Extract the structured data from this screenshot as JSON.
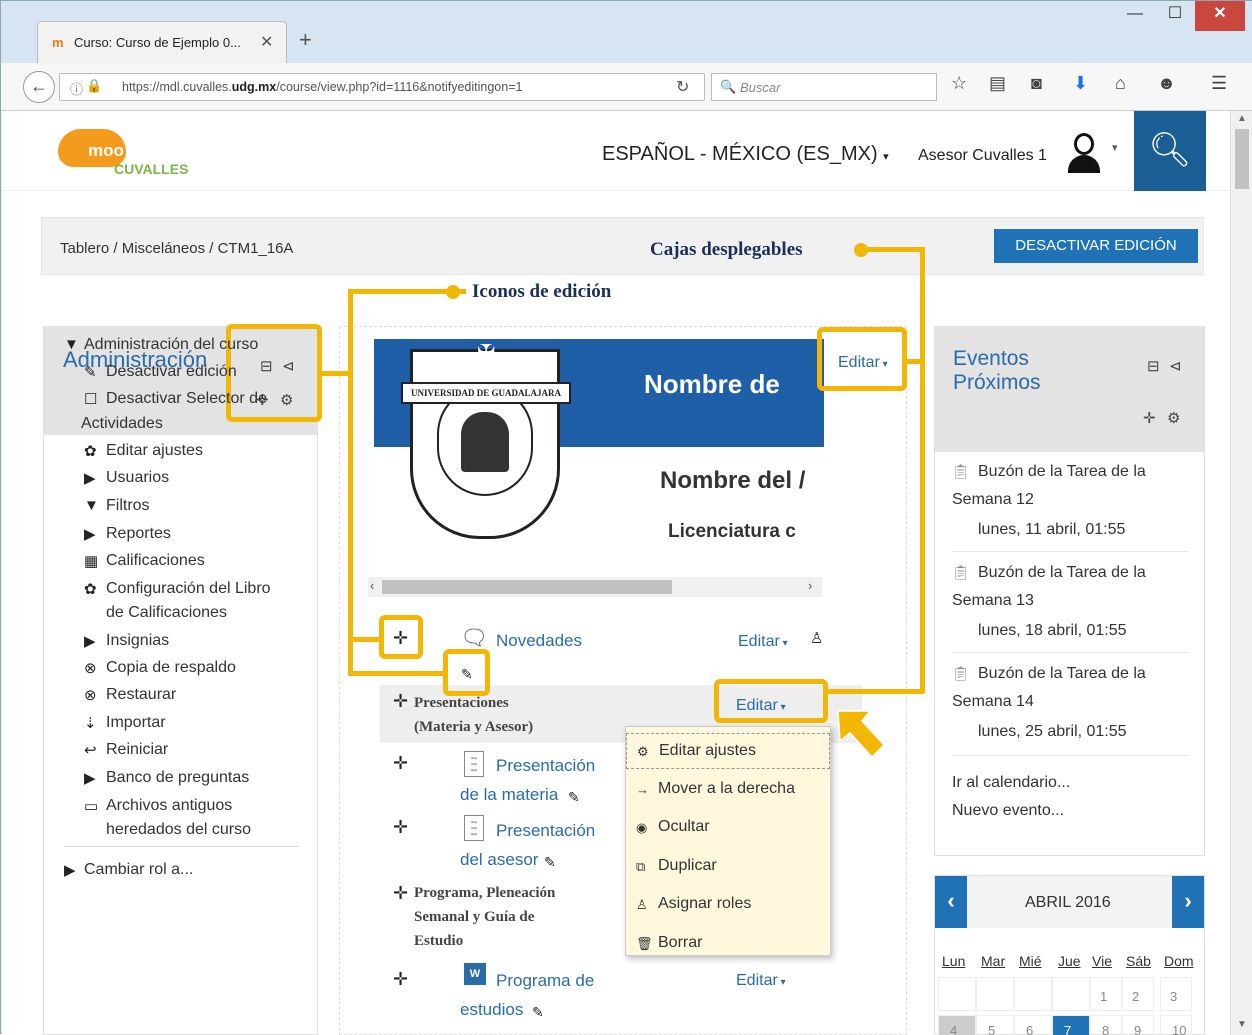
{
  "browser": {
    "tab_title": "Curso: Curso de Ejemplo 0...",
    "tab_favicon": "m",
    "tab_close": "✕",
    "new_tab": "+",
    "url_prefix": "https://mdl.cuvalles.",
    "url_domain": "udg.mx",
    "url_rest": "/course/view.php?id=1116&notifyeditingon=1",
    "search_placeholder": "Buscar",
    "min": "—",
    "max": "☐",
    "close": "✕"
  },
  "header": {
    "logo_text": "moo",
    "logo_sub": "CUVALLES",
    "language": "ESPAÑOL - MÉXICO (ES_MX)",
    "user_name": "Asesor Cuvalles 1",
    "search_icon": "search-icon"
  },
  "breadcrumb": {
    "text": "Tablero  /  Misceláneos  /  CTM1_16A"
  },
  "desactivar_label": "DESACTIVAR EDICIÓN",
  "admin": {
    "title": "Administración",
    "items": [
      {
        "label": "Administración del curso",
        "icon": "▼"
      },
      {
        "label": "Desactivar edición",
        "icon": "✎"
      },
      {
        "label": "Desactivar Selector de",
        "icon": "☐"
      },
      {
        "label": "Actividades",
        "icon": ""
      },
      {
        "label": "Editar ajustes",
        "icon": "✿"
      },
      {
        "label": "Usuarios",
        "icon": "▶"
      },
      {
        "label": "Filtros",
        "icon": "▼"
      },
      {
        "label": "Reportes",
        "icon": "▶"
      },
      {
        "label": "Calificaciones",
        "icon": "▦"
      },
      {
        "label": "Configuración del Libro",
        "icon": "✿"
      },
      {
        "label": "de Calificaciones",
        "icon": ""
      },
      {
        "label": "Insignias",
        "icon": "▶"
      },
      {
        "label": "Copia de respaldo",
        "icon": "⊗"
      },
      {
        "label": "Restaurar",
        "icon": "⊗"
      },
      {
        "label": "Importar",
        "icon": "⇣"
      },
      {
        "label": "Reiniciar",
        "icon": "↩"
      },
      {
        "label": "Banco de preguntas",
        "icon": "▶"
      },
      {
        "label": "Archivos antiguos",
        "icon": "▭"
      },
      {
        "label": "heredados del curso",
        "icon": ""
      },
      {
        "label": "Cambiar rol a...",
        "icon": "▶"
      }
    ]
  },
  "banner": {
    "title": "Nombre de",
    "name": "Nombre del /",
    "program": "Licenciatura c",
    "ribbon": "UNIVERSIDAD DE GUADALAJARA"
  },
  "course": {
    "editar": "Editar",
    "novedades": "Novedades",
    "sec1_line1": "Presentaciones",
    "sec1_line2": "(Materia y Asesor)",
    "pres_materia_1": "Presentación",
    "pres_materia_2": "de la materia",
    "pres_asesor_1": "Presentación",
    "pres_asesor_2": "del asesor",
    "sec2_line1": "Programa, Pleneación",
    "sec2_line2": "Semanal y Guía de",
    "sec2_line3": "Estudio",
    "prog_1": "Programa de",
    "prog_2": "estudios"
  },
  "menu": [
    {
      "label": "Editar ajustes",
      "icon": "⚙"
    },
    {
      "label": "Mover a la derecha",
      "icon": "→"
    },
    {
      "label": "Ocultar",
      "icon": "◉"
    },
    {
      "label": "Duplicar",
      "icon": "⧉"
    },
    {
      "label": "Asignar roles",
      "icon": "♙"
    },
    {
      "label": "Borrar",
      "icon": "🗑"
    }
  ],
  "eventos": {
    "title": "Eventos Próximos",
    "items": [
      {
        "l1": "Buzón de la Tarea de la",
        "l2": "Semana 12",
        "l3": "lunes, 11 abril, 01:55"
      },
      {
        "l1": "Buzón de la Tarea de la",
        "l2": "Semana 13",
        "l3": "lunes, 18 abril, 01:55"
      },
      {
        "l1": "Buzón de la Tarea de la",
        "l2": "Semana 14",
        "l3": "lunes, 25 abril, 01:55"
      }
    ],
    "go_calendar": "Ir al calendario...",
    "new_event": "Nuevo evento..."
  },
  "calendar": {
    "month": "ABRIL 2016",
    "days_of_week": [
      "Lun",
      "Mar",
      "Mié",
      "Jue",
      "Vie",
      "Sáb",
      "Dom"
    ],
    "row1": [
      "",
      "",
      "",
      "",
      "1",
      "2",
      "3"
    ],
    "row2": [
      "4",
      "5",
      "6",
      "7",
      "8",
      "9",
      "10"
    ]
  },
  "annotations": {
    "cajas": "Cajas desplegables",
    "iconos": "Iconos de edición"
  }
}
